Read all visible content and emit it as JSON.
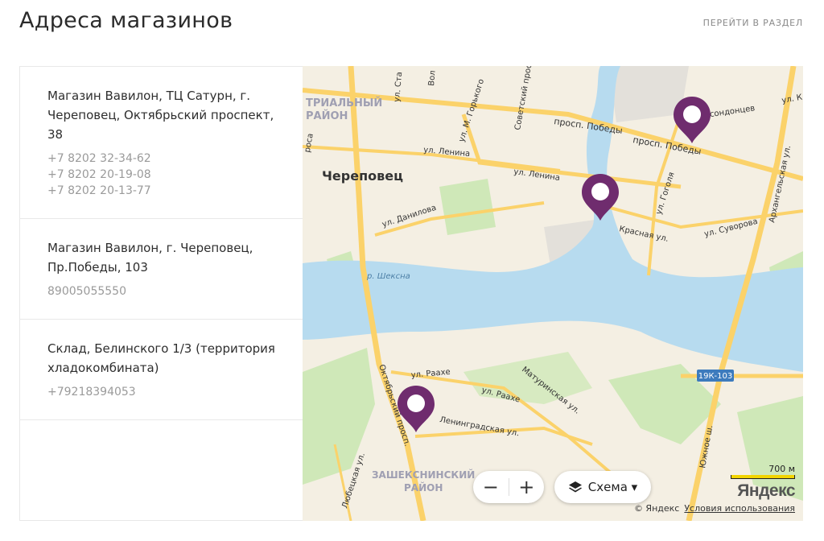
{
  "header": {
    "title": "Адреса магазинов",
    "goto_link": "ПЕРЕЙТИ В РАЗДЕЛ"
  },
  "stores": [
    {
      "name": "Магазин Вавилон, ТЦ Сатурн, г. Череповец, Октябрьский проспект, 38",
      "phones": [
        "+7 8202 32-34-62",
        "+7 8202 20-19-08",
        "+7 8202 20-13-77"
      ]
    },
    {
      "name": "Магазин Вавилон, г. Череповец, Пр.Победы, 103",
      "phones": [
        "89005055550"
      ]
    },
    {
      "name": "Склад, Белинского 1/3 (территория хладокомбината)",
      "phones": [
        "+79218394053"
      ]
    }
  ],
  "map": {
    "city_label": "Череповец",
    "district_labels": [
      "ТРИАЛЬНЫЙ",
      "РАЙОН",
      "ЗАШЕКСНИНСКИЙ",
      "РАЙОН"
    ],
    "river_label": "р. Шексна",
    "street_labels": [
      "ул. Ста",
      "Вол",
      "ул. М. Горького",
      "Советский прос",
      "просп. Победы",
      "просп. Победы",
      "ул. Ленина",
      "ул. Ленина",
      "ул. Данилова",
      "ул. Гоголя",
      "Красная ул.",
      "ул. Суворова",
      "Архангельская ул.",
      "ул. Раахе",
      "ул. Раахе",
      "Октябрьский просп.",
      "Матуринская ул.",
      "Ленинградская ул.",
      "Южное ш.",
      "Любецкая ул.",
      "ул. К",
      "нсондонцев",
      "роса"
    ],
    "road_badge": "19К-103",
    "zoom_out": "−",
    "zoom_in": "+",
    "layer_button": "Схема ▾",
    "scale_label": "700 м",
    "provider_logo": "Яндекс",
    "copyright": "© Яндекс",
    "terms_link": "Условия использования",
    "colors": {
      "marker": "#6f2c6e",
      "water": "#b7dbef",
      "land": "#f4efe3",
      "green": "#cfe8b8",
      "road": "#fbd26a"
    }
  }
}
